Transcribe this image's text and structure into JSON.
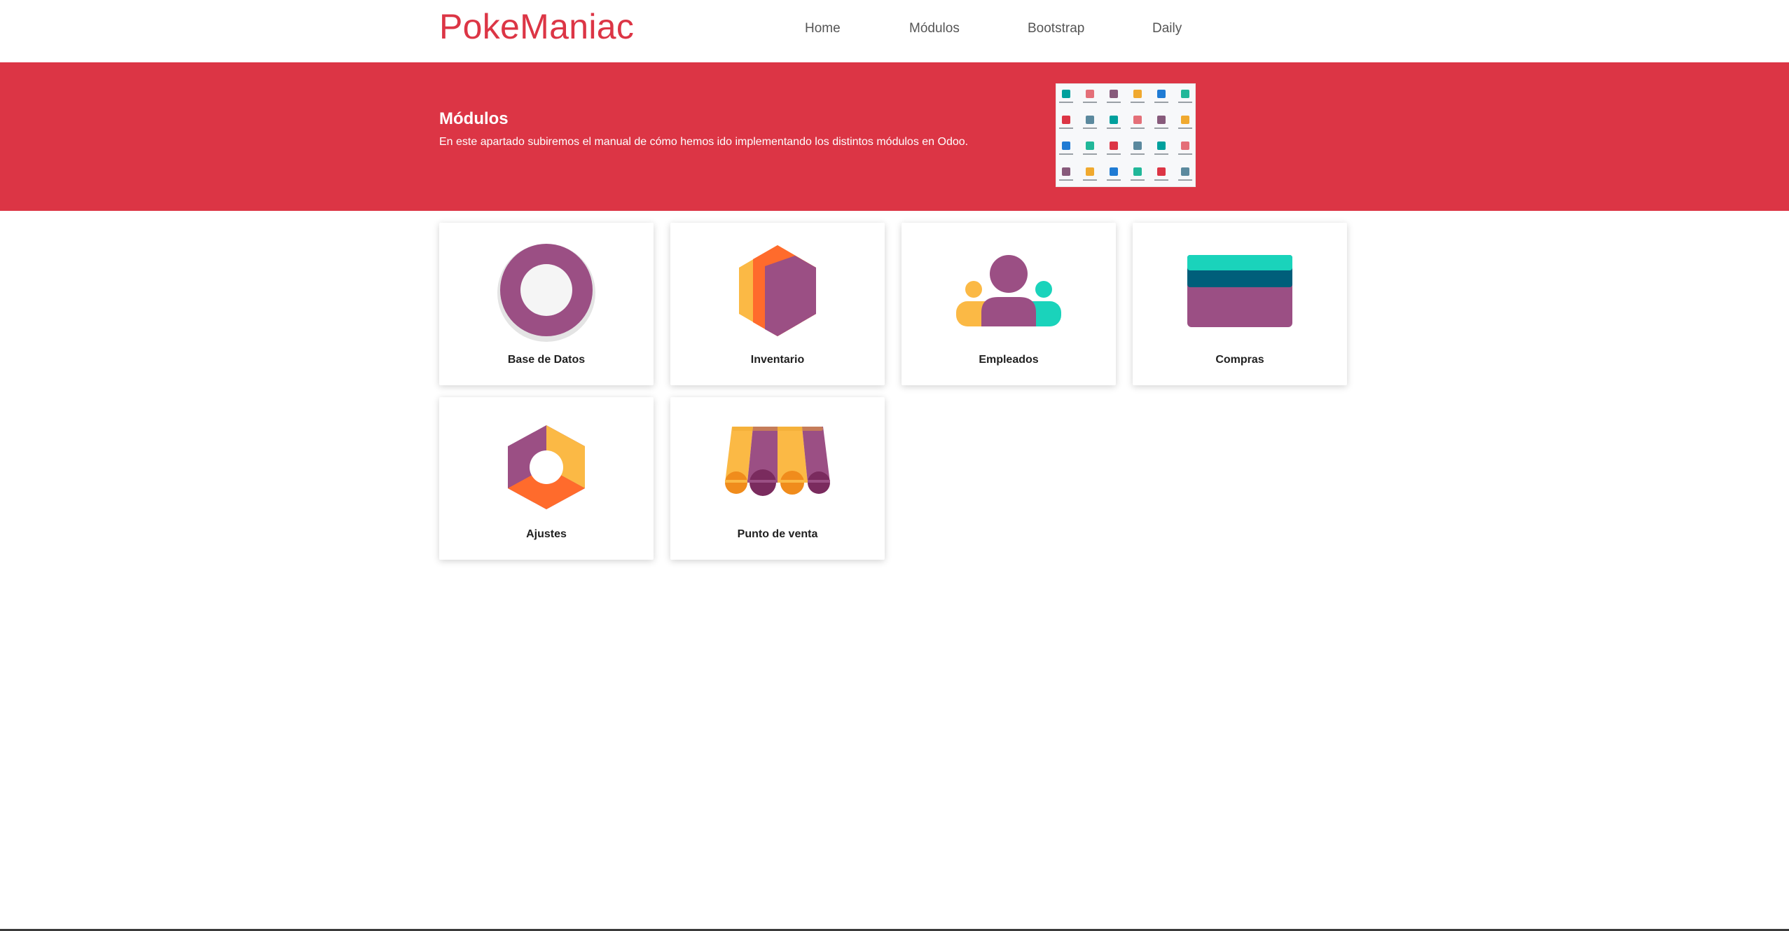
{
  "navbar": {
    "brand": "PokeManiac",
    "links": [
      "Home",
      "Módulos",
      "Bootstrap",
      "Daily"
    ]
  },
  "hero": {
    "title": "Módulos",
    "description": "En este apartado subiremos el manual de cómo hemos ido implementando los distintos módulos en Odoo."
  },
  "modules": [
    {
      "label": "Base de Datos",
      "icon": "database-ring-icon"
    },
    {
      "label": "Inventario",
      "icon": "inventory-hexagon-icon"
    },
    {
      "label": "Empleados",
      "icon": "employees-icon"
    },
    {
      "label": "Compras",
      "icon": "purchase-card-icon"
    },
    {
      "label": "Ajustes",
      "icon": "settings-hexagon-icon"
    },
    {
      "label": "Punto de venta",
      "icon": "point-of-sale-awning-icon"
    }
  ],
  "colors": {
    "brand": "#dc3545",
    "purple": "#9b4f84",
    "orange": "#ff6b2c",
    "yellow": "#fbb945",
    "teal": "#1ad3bb",
    "dark_teal": "#005e7a"
  }
}
